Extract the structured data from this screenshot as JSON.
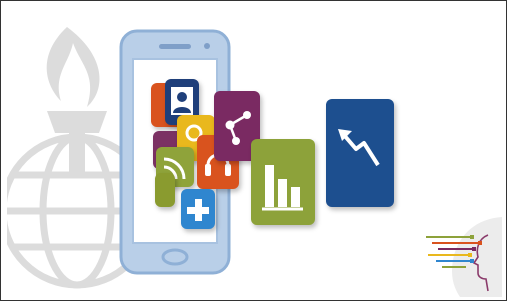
{
  "colors": {
    "background": "#ffffff",
    "watermark": "#d9d9d9",
    "phone_body": "#b8cde6",
    "phone_screen": "#ffffff",
    "orange": "#d9531e",
    "purple": "#7a2a62",
    "navy": "#1f3f7a",
    "yellow": "#e9b81d",
    "green": "#8da23a",
    "blue": "#2f86cf",
    "trend_blue": "#1d4f8f"
  },
  "icons": {
    "watermark": "university-torch-globe-icon",
    "user": "user-icon",
    "search": "search-icon",
    "rss": "rss-icon",
    "headset": "headset-icon",
    "plus": "plus-icon",
    "share": "share-nodes-icon",
    "bars": "bar-chart-icon",
    "trend": "trend-down-arrow-icon",
    "logo": "profile-head-logo-icon"
  }
}
